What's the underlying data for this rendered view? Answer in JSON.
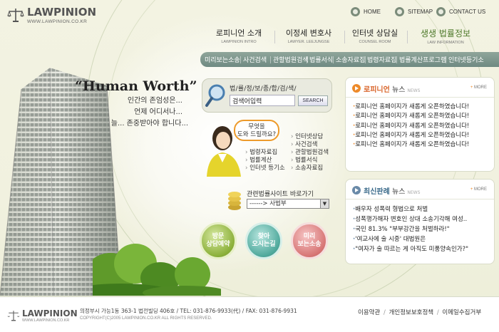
{
  "header": {
    "logo_text": "LAWPINION",
    "logo_url": "WWW.LAWPINION.CO.KR",
    "top_links": [
      {
        "label": "HOME",
        "icon": "home-icon"
      },
      {
        "label": "SITEMAP",
        "icon": "sitemap-icon"
      },
      {
        "label": "CONTACT US",
        "icon": "contact-icon"
      }
    ]
  },
  "main_nav": [
    {
      "ko": "로피니언 소개",
      "en": "LAWPINION INTRO"
    },
    {
      "ko": "이정세 변호사",
      "en": "LAWYER. LEEJUNGSE"
    },
    {
      "ko": "인터넷 상담실",
      "en": "COUNSEL ROOM"
    },
    {
      "ko": "생생 법률정보",
      "en": "LAW INFORMATION"
    }
  ],
  "sub_nav": [
    "미리보는소송",
    "사건검색",
    "관할법원검색",
    "법률서식",
    "소송자료집",
    "법령자료집",
    "법률계산프로그램",
    "인터넷등기소"
  ],
  "hero": {
    "slogan": "“Human Worth”",
    "lines": [
      "인간의 존엄성은...",
      "언제 어디서나...",
      "늘...  존중받아야 합니다..."
    ]
  },
  "search": {
    "title": "법/률/정/보/종/합/검/색/",
    "input_value": "검색어입력",
    "button_label": "SEARCH"
  },
  "help": {
    "bubble": [
      "무엇을",
      "도와 드릴까요?"
    ],
    "left_links": [
      "법령자료집",
      "법률계산",
      "인터넷 등기소"
    ],
    "right_links": [
      "인터넷상담",
      "사건검색",
      "관할법원검색",
      "법률서식",
      "소송자료집"
    ]
  },
  "related": {
    "label": "관련법률사이트 바로가기",
    "selected": "------> 사법부"
  },
  "round_buttons": [
    {
      "line1": "방문",
      "line2": "상담예약"
    },
    {
      "line1": "찾아",
      "line2": "오시는길"
    },
    {
      "line1": "미리",
      "line2": "보는소송"
    }
  ],
  "news": {
    "title_hl": "로피니언",
    "title_rest": " 뉴스",
    "title_en": "NEWS",
    "more": "MORE",
    "items": [
      "로피니언 홈페이지가 새롭게 오픈하였습니다!",
      "로피니언 홈페이지가 새롭게 오픈하였습니다!",
      "로피니언 홈페이지가 새롭게 오픈하였습니다!",
      "로피니언 홈페이지가 새롭게 오픈하였습니다!",
      "로피니언 홈페이지가 새롭게 오픈하였습니다!"
    ]
  },
  "related_news": {
    "title_hl": "최신판례",
    "title_rest": " 뉴스",
    "title_en": "NEWS",
    "more": "MORE",
    "items": [
      "배우자 성폭력 형법으로 처벌",
      "성폭행가해자 변호인 상대 소송기각해 여성..",
      "국민 81.3% \"부부강간을 처벌하라!\"",
      "'여교사에 술 시중' 대법원은",
      "\"여자가 술 따르는 게 아직도 미풍양속인가?\""
    ]
  },
  "footer": {
    "logo_text": "LAWPINION",
    "logo_url": "WWW.LAWPINION.CO.KR",
    "address": "의정부시 가능1동 363-1 법전빌딩 406호 / TEL: 031-876-9933(代) / FAX: 031-876-9931",
    "copyright": "COPYRIGHT(C)2005 LAWPINION.CO.KR ALL RIGHTS RESERVED.",
    "links": [
      "이용약관",
      "개인정보보호정책",
      "이메일수집거부"
    ]
  }
}
